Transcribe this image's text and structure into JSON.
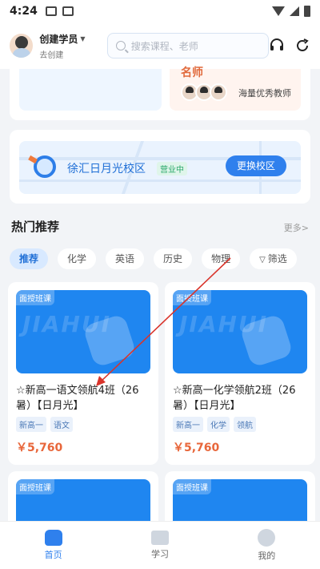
{
  "status_bar": {
    "time": "4:24",
    "icons": [
      "image-icon",
      "a-icon",
      "wifi-icon",
      "signal-icon",
      "battery-icon"
    ]
  },
  "header": {
    "user_name": "创建学员",
    "user_sub": "去创建",
    "search_placeholder": "搜索课程、老师",
    "icons": [
      "headset-icon",
      "refresh-icon"
    ]
  },
  "promo": {
    "title_partial": "名师",
    "teachers_text": "海量优秀教师"
  },
  "campus": {
    "name": "徐汇日月光校区",
    "status": "营业中",
    "button": "更换校区"
  },
  "section": {
    "title": "热门推荐",
    "more": "更多>"
  },
  "tabs": [
    {
      "label": "推荐",
      "active": true
    },
    {
      "label": "化学",
      "active": false
    },
    {
      "label": "英语",
      "active": false
    },
    {
      "label": "历史",
      "active": false
    },
    {
      "label": "物理",
      "active": false
    },
    {
      "label": "筛选",
      "active": false
    }
  ],
  "courses": [
    {
      "badge": "面授班课",
      "watermark": "JIAHUI",
      "title": "☆新高一语文领航4班（26暑）【日月光】",
      "tags": [
        "新高一",
        "语文"
      ],
      "price": "￥5,760"
    },
    {
      "badge": "面授班课",
      "watermark": "JIAHUI",
      "title": "☆新高一化学领航2班（26暑）【日月光】",
      "tags": [
        "新高一",
        "化学",
        "领航"
      ],
      "price": "￥5,760"
    },
    {
      "badge": "面授班课",
      "watermark": "",
      "title": "",
      "tags": [],
      "price": ""
    },
    {
      "badge": "面授班课",
      "watermark": "",
      "title": "",
      "tags": [],
      "price": ""
    }
  ],
  "bottom_nav": [
    {
      "label": "首页",
      "icon": "home-icon",
      "active": true
    },
    {
      "label": "学习",
      "icon": "book-icon",
      "active": false
    },
    {
      "label": "我的",
      "icon": "me-icon",
      "active": false
    }
  ],
  "colors": {
    "accent": "#2f80ed",
    "price": "#e8663a",
    "annotation_arrow": "#d9342b"
  }
}
